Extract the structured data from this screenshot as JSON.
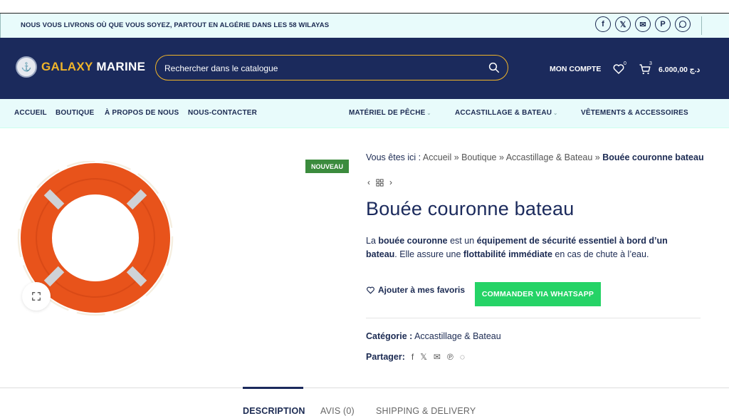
{
  "topbar": {
    "message": "NOUS VOUS LIVRONS OÙ QUE VOUS SOYEZ, PARTOUT EN ALGÉRIE DANS LES 58 WILAYAS",
    "socials": [
      "facebook-icon",
      "x-icon",
      "email-icon",
      "pinterest-icon",
      "whatsapp-icon"
    ]
  },
  "header": {
    "logo_first": "GALAXY",
    "logo_second": " MARINE",
    "search_placeholder": "Rechercher dans le catalogue",
    "account": "MON COMPTE",
    "wishlist_count": "0",
    "cart_count": "3",
    "cart_total": "6.000,00 د.ج"
  },
  "nav": {
    "items": [
      "ACCUEIL",
      "BOUTIQUE",
      "À PROPOS DE NOUS",
      "NOUS-CONTACTER",
      "MATÉRIEL DE PÊCHE",
      "ACCASTILLAGE & BATEAU",
      "VÊTEMENTS & ACCESSOIRES"
    ]
  },
  "product": {
    "badge": "NOUVEAU",
    "breadcrumb": {
      "prefix": "Vous êtes ici : ",
      "home": "Accueil",
      "sep": " » ",
      "shop": "Boutique",
      "category": "Accastillage & Bateau",
      "current": "Bouée couronne bateau"
    },
    "title": "Bouée couronne bateau",
    "desc": {
      "p1": "La ",
      "b1": "bouée couronne",
      "p2": " est un ",
      "b2": "équipement de sécurité essentiel à bord d’un bateau",
      "p3": ". Elle assure une ",
      "b3": "flottabilité immédiate",
      "p4": " en cas de chute à l’eau."
    },
    "wishlist_label": "Ajouter à mes favoris",
    "whatsapp_label": "COMMANDER VIA WHATSAPP",
    "category_label": "Catégorie :",
    "category_value": "Accastillage & Bateau",
    "share_label": "Partager:"
  },
  "tabs": [
    "DESCRIPTION",
    "AVIS (0)",
    "SHIPPING & DELIVERY"
  ],
  "colors": {
    "navy": "#1b2a5c",
    "gold": "#f0b429",
    "green": "#25d366",
    "badge": "#3b8b3d"
  }
}
